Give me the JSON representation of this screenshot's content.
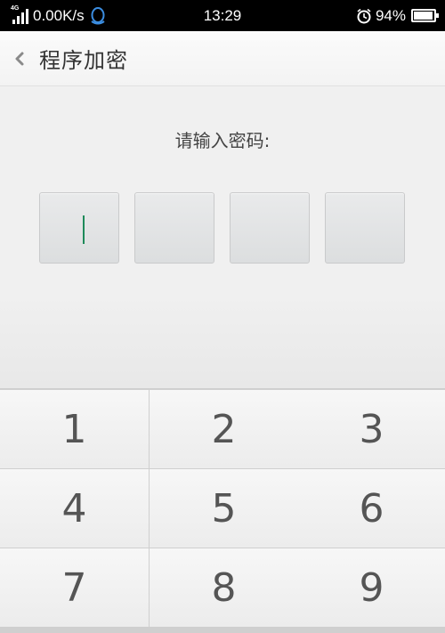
{
  "status_bar": {
    "network": "4G",
    "speed": "0.00K/s",
    "time": "13:29",
    "battery": "94%",
    "battery_level": 0.94,
    "icons": [
      "signal-icon",
      "qq-icon",
      "alarm-icon",
      "battery-icon"
    ]
  },
  "header": {
    "back_icon": "chevron-left-icon",
    "title": "程序加密"
  },
  "main": {
    "prompt": "请输入密码:",
    "pin_boxes": 4,
    "active_box": 1
  },
  "keypad": {
    "keys": [
      "1",
      "2",
      "3",
      "4",
      "5",
      "6",
      "7",
      "8",
      "9"
    ]
  },
  "colors": {
    "status_bar_bg": "#000000",
    "cursor": "#1e8a5a",
    "background": "#f0f0f0"
  }
}
